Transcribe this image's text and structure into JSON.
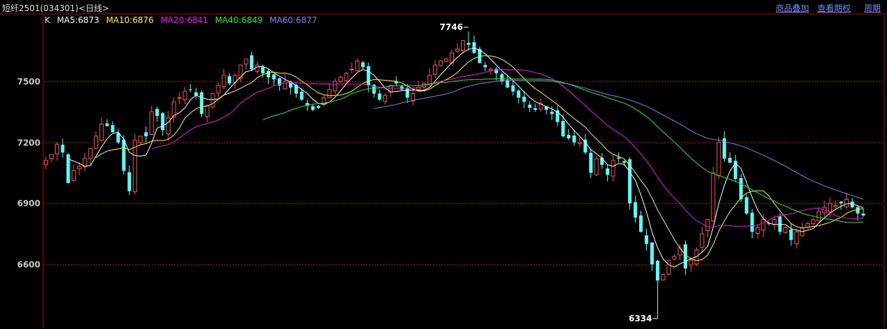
{
  "header": {
    "title": "短纤2501(034301)<日线>",
    "menu": [
      "商品叠加",
      "查看期权",
      "周期"
    ]
  },
  "legend": {
    "k": "K",
    "ma5": "MA5:6873",
    "ma10": "MA10:6876",
    "ma20": "MA20:6841",
    "ma40": "MA40:6849",
    "ma60": "MA60:6877"
  },
  "colors": {
    "up": "#ff4a4a",
    "down": "#54ffff",
    "ma5": "#ffffff",
    "ma10": "#ffff00",
    "ma20": "#ff00ff",
    "ma40": "#00ff00",
    "ma60": "#8080ff",
    "grid": "#b00000",
    "axis_text": "#c8c8c8"
  },
  "chart_data": {
    "type": "candlestick",
    "ylim": [
      6334,
      7746
    ],
    "y_ticks": [
      7500,
      7200,
      6900,
      6600
    ],
    "high_label": "7746",
    "low_label": "6334",
    "high_value": 7746,
    "low_value": 6334,
    "closes": [
      7110,
      7140,
      7190,
      7150,
      7000,
      7060,
      7080,
      7120,
      7170,
      7230,
      7290,
      7280,
      7250,
      7200,
      7060,
      6960,
      7210,
      7230,
      7230,
      7350,
      7330,
      7260,
      7320,
      7400,
      7420,
      7450,
      7460,
      7430,
      7340,
      7380,
      7440,
      7480,
      7530,
      7490,
      7530,
      7580,
      7610,
      7560,
      7580,
      7540,
      7520,
      7510,
      7480,
      7500,
      7470,
      7440,
      7410,
      7380,
      7360,
      7370,
      7420,
      7460,
      7500,
      7520,
      7540,
      7560,
      7600,
      7570,
      7480,
      7440,
      7410,
      7430,
      7480,
      7490,
      7460,
      7420,
      7440,
      7470,
      7490,
      7530,
      7580,
      7600,
      7610,
      7640,
      7660,
      7700,
      7680,
      7640,
      7590,
      7570,
      7560,
      7540,
      7500,
      7470,
      7450,
      7420,
      7400,
      7370,
      7360,
      7390,
      7360,
      7340,
      7300,
      7230,
      7220,
      7200,
      7200,
      7150,
      7050,
      7120,
      7090,
      7040,
      7110,
      7120,
      7100,
      6900,
      6830,
      6760,
      6700,
      6600,
      6520,
      6550,
      6620,
      6640,
      6680,
      6580,
      6620,
      6670,
      6750,
      6820,
      7050,
      7200,
      7120,
      7100,
      7020,
      6920,
      6850,
      6760,
      6780,
      6820,
      6800,
      6820,
      6760,
      6780,
      6720,
      6760,
      6780,
      6800,
      6820,
      6860,
      6880,
      6900,
      6890,
      6900,
      6920,
      6880,
      6850,
      6840
    ]
  }
}
